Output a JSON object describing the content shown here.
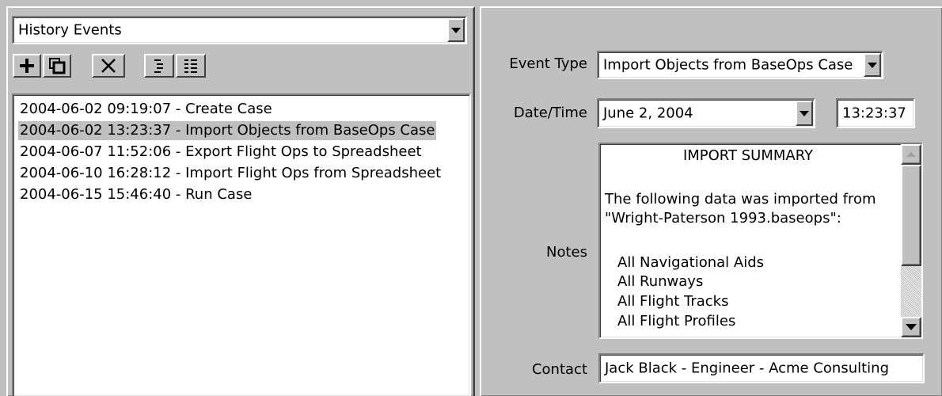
{
  "history": {
    "dropdown_value": "History Events",
    "events": [
      "2004-06-02 09:19:07 - Create Case",
      "2004-06-02 13:23:37 - Import Objects from BaseOps Case",
      "2004-06-07 11:52:06 - Export Flight Ops to Spreadsheet",
      "2004-06-10 16:28:12 - Import Flight Ops from Spreadsheet",
      "2004-06-15 15:46:40 - Run Case"
    ],
    "selected_index": 1
  },
  "toolbar": {
    "icons": [
      "add-icon",
      "copy-icon",
      "delete-icon",
      "expand-icon",
      "collapse-icon"
    ]
  },
  "details": {
    "event_type_label": "Event Type",
    "event_type_value": "Import Objects from BaseOps Case",
    "datetime_label": "Date/Time",
    "date_value": "June 2, 2004",
    "time_value": "13:23:37",
    "notes_label": "Notes",
    "notes": {
      "heading": "IMPORT SUMMARY",
      "line1": "The following data was imported from",
      "line2": "\"Wright-Paterson 1993.baseops\":",
      "items": [
        "All Navigational Aids",
        "All Runways",
        "All Flight Tracks",
        "All Flight Profiles"
      ]
    },
    "contact_label": "Contact",
    "contact_value": "Jack Black - Engineer - Acme Consulting"
  }
}
